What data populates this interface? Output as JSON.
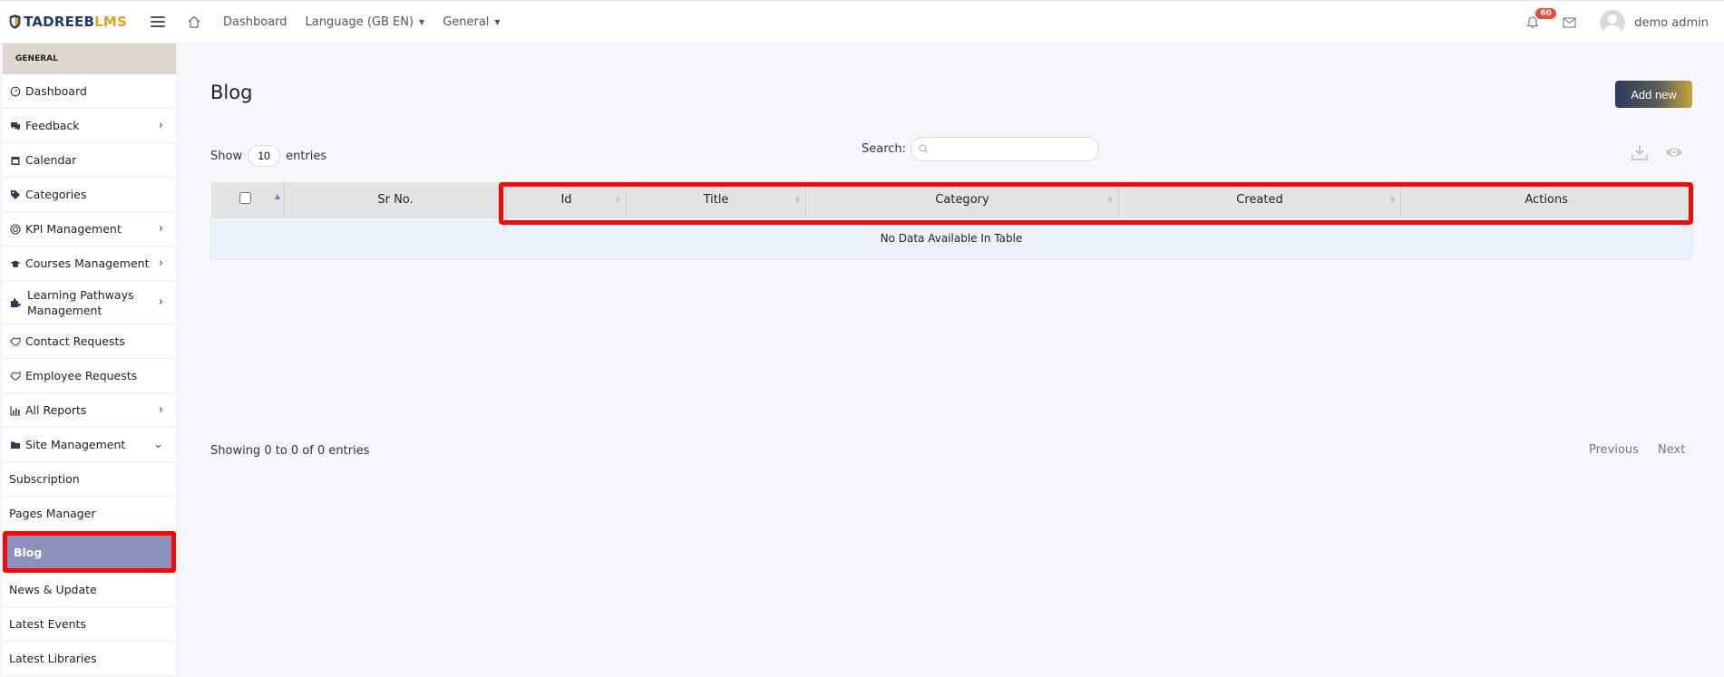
{
  "brand": {
    "part1": "TADREEB",
    "part2": "LMS"
  },
  "topnav": {
    "dashboard": "Dashboard",
    "language": "Language (GB EN)",
    "general": "General",
    "notif_count": "60",
    "user": "demo admin"
  },
  "sidebar": {
    "section": "GENERAL",
    "items": [
      {
        "label": "Dashboard"
      },
      {
        "label": "Feedback"
      },
      {
        "label": "Calendar"
      },
      {
        "label": "Categories"
      },
      {
        "label": "KPI Management"
      },
      {
        "label": "Courses Management"
      },
      {
        "label": "Learning Pathways Management"
      },
      {
        "label": "Contact Requests"
      },
      {
        "label": "Employee Requests"
      },
      {
        "label": "All Reports"
      },
      {
        "label": "Site Management"
      },
      {
        "label": "Subscription"
      },
      {
        "label": "Pages Manager"
      },
      {
        "label": "Blog"
      },
      {
        "label": "News & Update"
      },
      {
        "label": "Latest Events"
      },
      {
        "label": "Latest Libraries"
      }
    ]
  },
  "page": {
    "title": "Blog",
    "add_label": "Add new",
    "show_label": "Show",
    "entries_value": "10",
    "entries_label": "entries",
    "search_label": "Search:",
    "search_value": ""
  },
  "table": {
    "columns": [
      "Sr No.",
      "Id",
      "Title",
      "Category",
      "Created",
      "Actions"
    ],
    "empty": "No Data Available In Table"
  },
  "footer": {
    "info": "Showing 0 to 0 of 0 entries",
    "previous": "Previous",
    "next": "Next"
  },
  "colors": {
    "highlight": "#f50a0a",
    "active_item": "#8c92bb",
    "badge": "#e84c3d"
  }
}
